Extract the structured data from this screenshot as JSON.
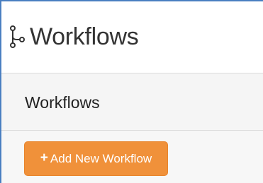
{
  "header": {
    "title": "Workflows",
    "icon": "workflow-branch-icon"
  },
  "panel": {
    "heading": "Workflows",
    "add_button": {
      "icon": "plus-icon",
      "label": "Add New Workflow"
    }
  },
  "colors": {
    "accent": "#f0913a",
    "frame": "#4a7fc1",
    "panel_bg": "#f5f5f5"
  }
}
